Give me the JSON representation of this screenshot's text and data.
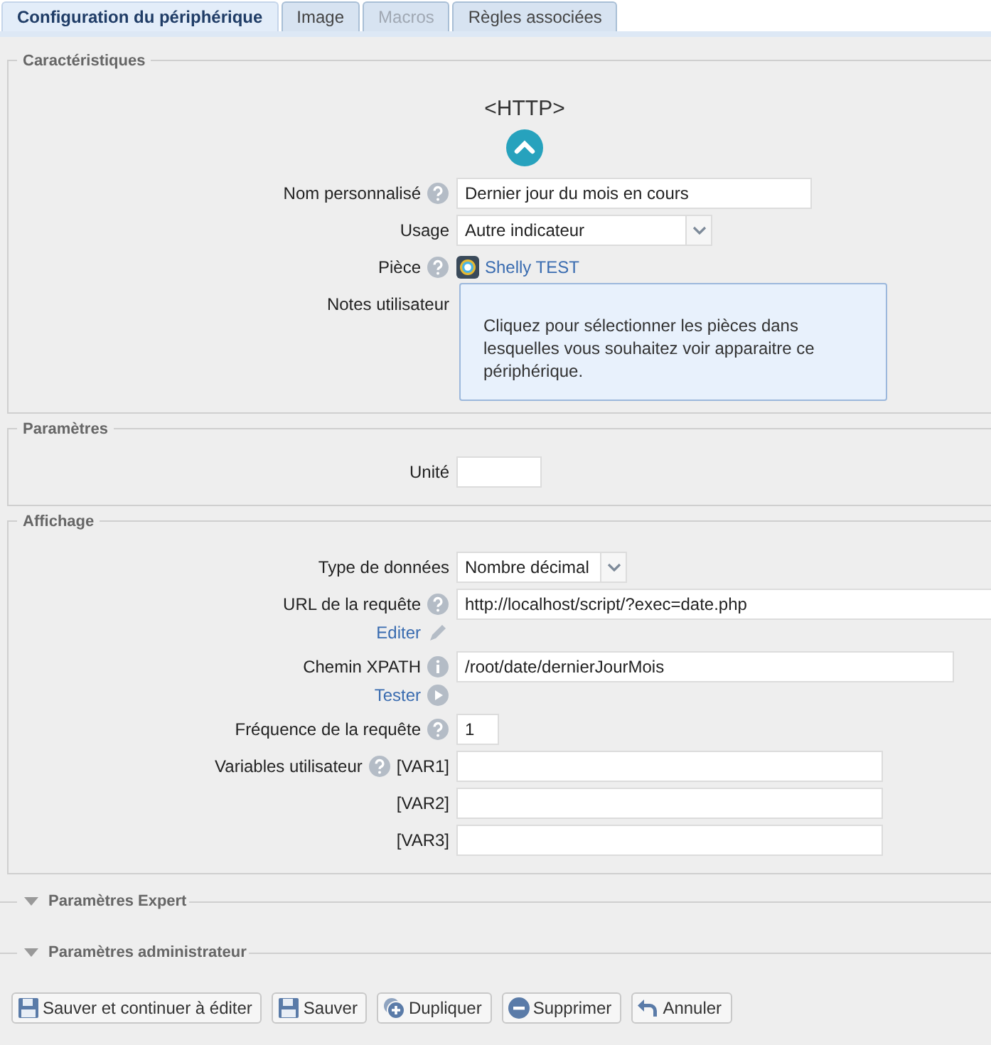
{
  "tabs": [
    {
      "label": "Configuration du périphérique",
      "selected": true,
      "disabled": false
    },
    {
      "label": "Image",
      "selected": false,
      "disabled": false
    },
    {
      "label": "Macros",
      "selected": false,
      "disabled": true
    },
    {
      "label": "Règles associées",
      "selected": false,
      "disabled": false
    }
  ],
  "device_type": "<HTTP>",
  "sections": [
    {
      "legend": "Caractéristiques",
      "rows": [
        {
          "kind": "text",
          "label": "Nom personnalisé",
          "value": "Dernier jour du mois en cours"
        },
        {
          "kind": "select",
          "label": "Usage",
          "value": "Autre indicateur"
        },
        {
          "kind": "room",
          "label": "Pièce",
          "value": "Shelly TEST"
        },
        {
          "kind": "notes",
          "label": "Notes utilisateur",
          "tooltip": "Cliquez pour sélectionner les pièces dans lesquelles vous souhaitez voir apparaitre ce périphérique."
        }
      ]
    },
    {
      "legend": "Paramètres",
      "rows": [
        {
          "kind": "text",
          "label": "Unité"
        }
      ]
    },
    {
      "legend": "Affichage",
      "rows": [
        {
          "kind": "select",
          "label": "Type de données",
          "value": "Nombre décimal"
        },
        {
          "kind": "text",
          "label": "URL de la requête",
          "value": "http://localhost/script/?exec=date.php",
          "link": "Editer"
        },
        {
          "kind": "text",
          "label": "Chemin XPATH",
          "value": "/root/date/dernierJourMois",
          "link": "Tester"
        },
        {
          "kind": "text",
          "label": "Fréquence de la requête",
          "value": "1"
        },
        {
          "kind": "text",
          "label": "Variables utilisateur",
          "prefix": "[VAR1]"
        },
        {
          "kind": "text",
          "prefix": "[VAR2]"
        },
        {
          "kind": "text",
          "prefix": "[VAR3]"
        }
      ]
    }
  ],
  "collapsed_sections": [
    {
      "legend": "Paramètres Expert",
      "expanded": false
    },
    {
      "legend": "Paramètres administrateur",
      "expanded": false
    }
  ],
  "buttons": [
    "Sauver et continuer à éditer",
    "Sauver",
    "Dupliquer",
    "Supprimer",
    "Annuler"
  ]
}
